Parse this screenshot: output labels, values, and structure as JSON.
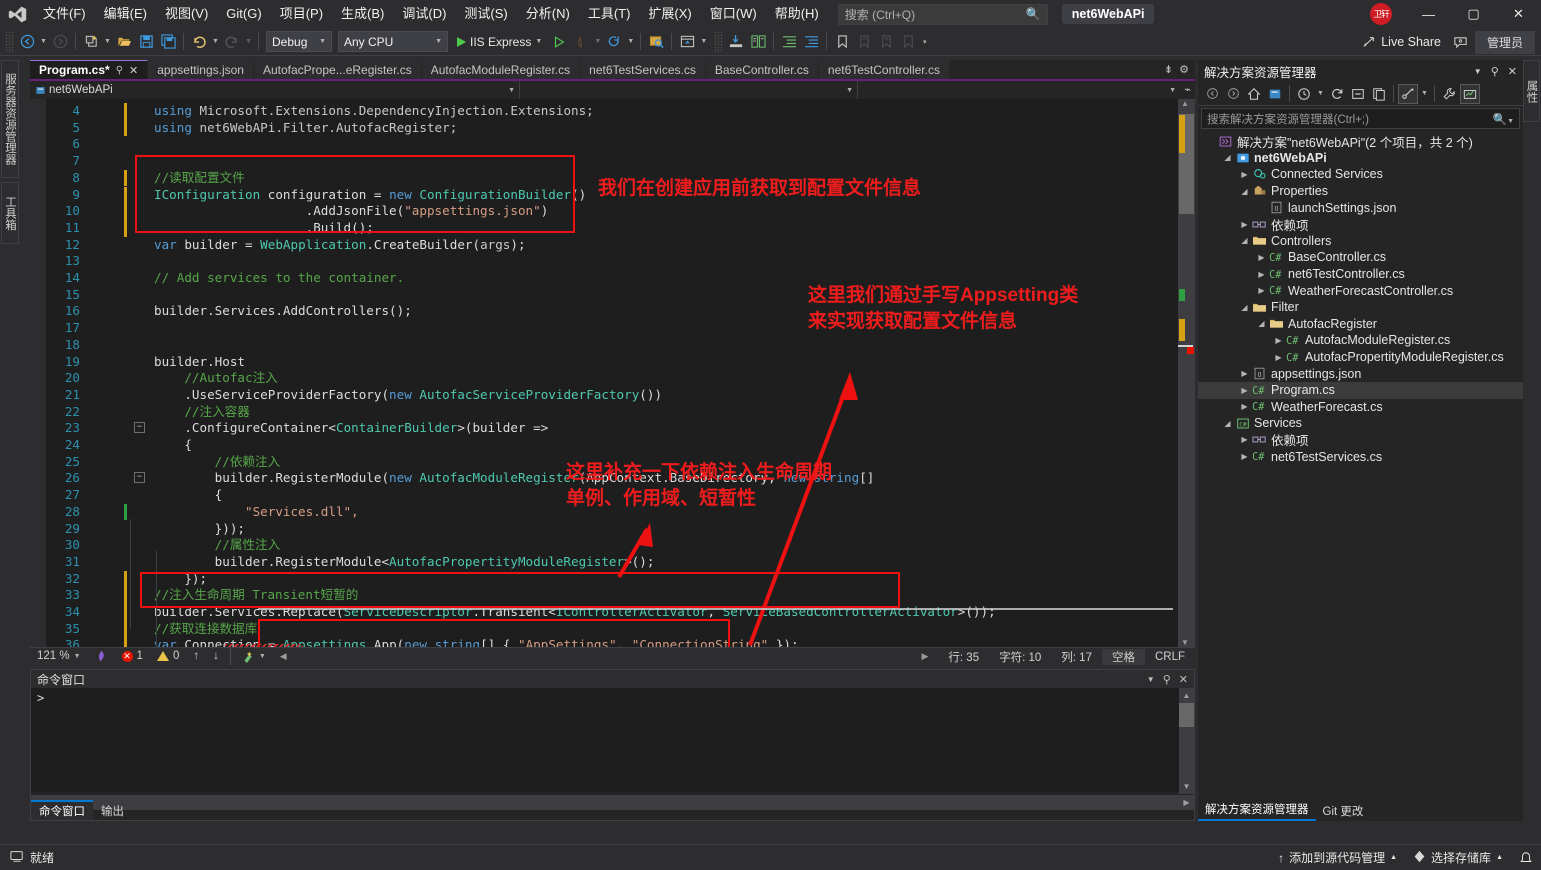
{
  "titlebar": {
    "menu": [
      "文件(F)",
      "编辑(E)",
      "视图(V)",
      "Git(G)",
      "项目(P)",
      "生成(B)",
      "调试(D)",
      "测试(S)",
      "分析(N)",
      "工具(T)",
      "扩展(X)",
      "窗口(W)",
      "帮助(H)"
    ],
    "search_placeholder": "搜索 (Ctrl+Q)",
    "project_chip": "net6WebAPi",
    "avatar_text": "卫轩",
    "minimize": "—",
    "maximize": "▢",
    "close": "✕"
  },
  "toolbar": {
    "config": "Debug",
    "platform": "Any CPU",
    "run_label": "IIS Express",
    "live_share": "Live Share",
    "admin": "管理员"
  },
  "left_dock": {
    "tabs": [
      "服务器资源管理器",
      "工具箱"
    ]
  },
  "right_dock": {
    "tabs": [
      "属性"
    ]
  },
  "editor_tabs": [
    {
      "label": "Program.cs*",
      "active": true,
      "pin": "⚲",
      "close": "✕"
    },
    {
      "label": "appsettings.json",
      "active": false
    },
    {
      "label": "AutofacPrope...eRegister.cs",
      "active": false
    },
    {
      "label": "AutofacModuleRegister.cs",
      "active": false
    },
    {
      "label": "net6TestServices.cs",
      "active": false
    },
    {
      "label": "BaseController.cs",
      "active": false
    },
    {
      "label": "net6TestController.cs",
      "active": false
    }
  ],
  "navbar": {
    "project": "net6WebAPi",
    "type": "",
    "member": ""
  },
  "code": {
    "lines": [
      {
        "n": "4",
        "change": "yellow",
        "indent": 0,
        "tokens": [
          {
            "t": "using ",
            "c": "kw"
          },
          {
            "t": "Microsoft.Extensions.DependencyInjection.Extensions;",
            "c": "nsp"
          }
        ]
      },
      {
        "n": "5",
        "change": "yellow",
        "indent": 0,
        "tokens": [
          {
            "t": "using ",
            "c": "kw"
          },
          {
            "t": "net6WebAPi.Filter.AutofacRegister;",
            "c": "nsp"
          }
        ]
      },
      {
        "n": "6",
        "change": "",
        "indent": 0,
        "tokens": []
      },
      {
        "n": "7",
        "change": "",
        "indent": 0,
        "tokens": []
      },
      {
        "n": "8",
        "change": "yellow",
        "indent": 0,
        "tokens": [
          {
            "t": "//读取配置文件",
            "c": "cmt"
          }
        ]
      },
      {
        "n": "9",
        "change": "yellow",
        "indent": 0,
        "tokens": [
          {
            "t": "IConfiguration",
            "c": "typ"
          },
          {
            "t": " configuration = ",
            "c": "pln"
          },
          {
            "t": "new ",
            "c": "kw"
          },
          {
            "t": "ConfigurationBuilder",
            "c": "typ"
          },
          {
            "t": "()",
            "c": "pln"
          }
        ]
      },
      {
        "n": "10",
        "change": "yellow",
        "indent": 0,
        "tokens": [
          {
            "t": "                    .AddJsonFile(",
            "c": "pln"
          },
          {
            "t": "\"appsettings.json\"",
            "c": "str"
          },
          {
            "t": ")",
            "c": "pln"
          }
        ]
      },
      {
        "n": "11",
        "change": "yellow",
        "indent": 0,
        "tokens": [
          {
            "t": "                    .Build();",
            "c": "pln"
          }
        ]
      },
      {
        "n": "12",
        "change": "",
        "indent": 0,
        "tokens": [
          {
            "t": "var ",
            "c": "kw"
          },
          {
            "t": "builder = ",
            "c": "pln"
          },
          {
            "t": "WebApplication",
            "c": "typ"
          },
          {
            "t": ".CreateBuilder(",
            "c": "pln"
          },
          {
            "t": "args",
            "c": "nsp"
          },
          {
            "t": ");",
            "c": "pln"
          }
        ]
      },
      {
        "n": "13",
        "change": "",
        "indent": 0,
        "tokens": []
      },
      {
        "n": "14",
        "change": "",
        "indent": 0,
        "tokens": [
          {
            "t": "// Add services to the container.",
            "c": "cmt"
          }
        ]
      },
      {
        "n": "15",
        "change": "",
        "indent": 0,
        "tokens": []
      },
      {
        "n": "16",
        "change": "",
        "indent": 0,
        "tokens": [
          {
            "t": "builder.Services.AddControllers();",
            "c": "pln"
          }
        ]
      },
      {
        "n": "17",
        "change": "",
        "indent": 0,
        "tokens": []
      },
      {
        "n": "18",
        "change": "",
        "indent": 0,
        "tokens": []
      },
      {
        "n": "19",
        "change": "",
        "indent": 0,
        "tokens": [
          {
            "t": "builder.Host",
            "c": "pln"
          }
        ]
      },
      {
        "n": "20",
        "change": "",
        "indent": 0,
        "tokens": [
          {
            "t": "    //Autofac注入",
            "c": "cmt"
          }
        ]
      },
      {
        "n": "21",
        "change": "",
        "indent": 0,
        "tokens": [
          {
            "t": "    .UseServiceProviderFactory(",
            "c": "pln"
          },
          {
            "t": "new ",
            "c": "kw"
          },
          {
            "t": "AutofacServiceProviderFactory",
            "c": "typ"
          },
          {
            "t": "())",
            "c": "pln"
          }
        ]
      },
      {
        "n": "22",
        "change": "",
        "indent": 0,
        "tokens": [
          {
            "t": "    //注入容器",
            "c": "cmt"
          }
        ]
      },
      {
        "n": "23",
        "change": "",
        "indent": 0,
        "fold": true,
        "tokens": [
          {
            "t": "    .ConfigureContainer<",
            "c": "pln"
          },
          {
            "t": "ContainerBuilder",
            "c": "typ"
          },
          {
            "t": ">(builder =>",
            "c": "pln"
          }
        ]
      },
      {
        "n": "24",
        "change": "",
        "indent": 0,
        "tokens": [
          {
            "t": "    {",
            "c": "pln"
          }
        ]
      },
      {
        "n": "25",
        "change": "",
        "indent": 0,
        "tokens": [
          {
            "t": "        //依赖注入",
            "c": "cmt"
          }
        ]
      },
      {
        "n": "26",
        "change": "",
        "indent": 0,
        "fold": true,
        "tokens": [
          {
            "t": "        builder.RegisterModule(",
            "c": "pln"
          },
          {
            "t": "new ",
            "c": "kw"
          },
          {
            "t": "AutofacModuleRegister",
            "c": "typ"
          },
          {
            "t": "(AppContext.BaseDirectory, ",
            "c": "pln"
          },
          {
            "t": "new ",
            "c": "kw"
          },
          {
            "t": "string",
            "c": "kw"
          },
          {
            "t": "[]",
            "c": "pln"
          }
        ]
      },
      {
        "n": "27",
        "change": "",
        "indent": 0,
        "tokens": [
          {
            "t": "        {",
            "c": "pln"
          }
        ]
      },
      {
        "n": "28",
        "change": "green",
        "indent": 0,
        "tokens": [
          {
            "t": "            \"Services.dll\",",
            "c": "str"
          }
        ]
      },
      {
        "n": "29",
        "change": "",
        "indent": 0,
        "tokens": [
          {
            "t": "        }));",
            "c": "pln"
          }
        ]
      },
      {
        "n": "30",
        "change": "",
        "indent": 0,
        "tokens": [
          {
            "t": "        //属性注入",
            "c": "cmt"
          }
        ]
      },
      {
        "n": "31",
        "change": "",
        "indent": 0,
        "tokens": [
          {
            "t": "        builder.RegisterModule<",
            "c": "pln"
          },
          {
            "t": "AutofacPropertityModuleRegister",
            "c": "typ"
          },
          {
            "t": ">();",
            "c": "pln"
          }
        ]
      },
      {
        "n": "32",
        "change": "yellow",
        "indent": 0,
        "tokens": [
          {
            "t": "    });",
            "c": "pln"
          }
        ]
      },
      {
        "n": "33",
        "change": "yellow",
        "indent": 0,
        "tokens": [
          {
            "t": "//注入生命周期 Transient短暂的",
            "c": "cmt"
          }
        ]
      },
      {
        "n": "34",
        "change": "yellow",
        "indent": 0,
        "tokens": [
          {
            "t": "builder.Services.Replace(",
            "c": "pln"
          },
          {
            "t": "ServiceDescriptor",
            "c": "typ"
          },
          {
            "t": ".Transient<",
            "c": "pln"
          },
          {
            "t": "IControllerActivator",
            "c": "typ"
          },
          {
            "t": ", ",
            "c": "pln"
          },
          {
            "t": "ServiceBasedControllerActivator",
            "c": "typ"
          },
          {
            "t": ">());",
            "c": "pln"
          }
        ]
      },
      {
        "n": "35",
        "change": "yellow",
        "indent": 0,
        "tokens": [
          {
            "t": "//获取连接数据库",
            "c": "cmt"
          }
        ]
      },
      {
        "n": "36",
        "change": "yellow",
        "indent": 0,
        "tokens": [
          {
            "t": "var ",
            "c": "kw"
          },
          {
            "t": "Connection = ",
            "c": "pln"
          },
          {
            "t": "Appsettings",
            "c": "typ"
          },
          {
            "t": ".App(",
            "c": "pln"
          },
          {
            "t": "new ",
            "c": "kw"
          },
          {
            "t": "string",
            "c": "kw"
          },
          {
            "t": "[] { ",
            "c": "pln"
          },
          {
            "t": "\"AppSettings\"",
            "c": "str"
          },
          {
            "t": ", ",
            "c": "pln"
          },
          {
            "t": "\"ConnectionString\"",
            "c": "str"
          },
          {
            "t": " });",
            "c": "pln"
          }
        ]
      }
    ]
  },
  "annotations": [
    {
      "id": "anno-1",
      "text": "我们在创建应用前获取到配置文件信息"
    },
    {
      "id": "anno-2",
      "text": "这里我们通过手写Appsetting类\n来实现获取配置文件信息"
    },
    {
      "id": "anno-3",
      "text": "这里补充一下依赖注入生命周期\n单例、作用域、短暂性"
    }
  ],
  "editor_status": {
    "zoom": "121 %",
    "errors": "1",
    "warnings": "0",
    "line": "行: 35",
    "chars": "字符: 10",
    "col": "列: 17",
    "spaces": "空格",
    "eol": "CRLF"
  },
  "command_window": {
    "title": "命令窗口",
    "prompt": ">",
    "tabs": [
      {
        "label": "命令窗口",
        "active": true
      },
      {
        "label": "输出",
        "active": false
      }
    ]
  },
  "solution_explorer": {
    "title": "解决方案资源管理器",
    "search_placeholder": "搜索解决方案资源管理器(Ctrl+;)",
    "tree": [
      {
        "depth": 0,
        "tw": "",
        "icon": "solution",
        "label": "解决方案\"net6WebAPi\"(2 个项目，共 2 个)",
        "bold": false,
        "sel": false
      },
      {
        "depth": 1,
        "tw": "▾",
        "icon": "project",
        "label": "net6WebAPi",
        "bold": true,
        "sel": false
      },
      {
        "depth": 2,
        "tw": "▸",
        "icon": "connected",
        "label": "Connected Services",
        "bold": false,
        "sel": false
      },
      {
        "depth": 2,
        "tw": "▾",
        "icon": "props",
        "label": "Properties",
        "bold": false,
        "sel": false
      },
      {
        "depth": 3,
        "tw": "",
        "icon": "json",
        "label": "launchSettings.json",
        "bold": false,
        "sel": false
      },
      {
        "depth": 2,
        "tw": "▸",
        "icon": "deps",
        "label": "依赖项",
        "bold": false,
        "sel": false
      },
      {
        "depth": 2,
        "tw": "▾",
        "icon": "folder",
        "label": "Controllers",
        "bold": false,
        "sel": false
      },
      {
        "depth": 3,
        "tw": "▸",
        "icon": "cs",
        "label": "BaseController.cs",
        "bold": false,
        "sel": false
      },
      {
        "depth": 3,
        "tw": "▸",
        "icon": "cs",
        "label": "net6TestController.cs",
        "bold": false,
        "sel": false
      },
      {
        "depth": 3,
        "tw": "▸",
        "icon": "cs",
        "label": "WeatherForecastController.cs",
        "bold": false,
        "sel": false
      },
      {
        "depth": 2,
        "tw": "▾",
        "icon": "folder",
        "label": "Filter",
        "bold": false,
        "sel": false
      },
      {
        "depth": 3,
        "tw": "▾",
        "icon": "folder",
        "label": "AutofacRegister",
        "bold": false,
        "sel": false
      },
      {
        "depth": 4,
        "tw": "▸",
        "icon": "cs",
        "label": "AutofacModuleRegister.cs",
        "bold": false,
        "sel": false
      },
      {
        "depth": 4,
        "tw": "▸",
        "icon": "cs",
        "label": "AutofacPropertityModuleRegister.cs",
        "bold": false,
        "sel": false
      },
      {
        "depth": 2,
        "tw": "▸",
        "icon": "json",
        "label": "appsettings.json",
        "bold": false,
        "sel": false
      },
      {
        "depth": 2,
        "tw": "▸",
        "icon": "cs",
        "label": "Program.cs",
        "bold": false,
        "sel": true
      },
      {
        "depth": 2,
        "tw": "▸",
        "icon": "cs",
        "label": "WeatherForecast.cs",
        "bold": false,
        "sel": false
      },
      {
        "depth": 1,
        "tw": "▾",
        "icon": "csproj",
        "label": "Services",
        "bold": false,
        "sel": false
      },
      {
        "depth": 2,
        "tw": "▸",
        "icon": "deps",
        "label": "依赖项",
        "bold": false,
        "sel": false
      },
      {
        "depth": 2,
        "tw": "▸",
        "icon": "cs",
        "label": "net6TestServices.cs",
        "bold": false,
        "sel": false
      }
    ],
    "footer_tabs": [
      {
        "label": "解决方案资源管理器",
        "active": true
      },
      {
        "label": "Git 更改",
        "active": false
      }
    ]
  },
  "statusbar": {
    "ready": "就绪",
    "source_control": "添加到源代码管理",
    "repo": "选择存储库",
    "bell": "🔔"
  },
  "colors": {
    "accent_purple": "#68217a",
    "annotation_red": "#ee1c1c",
    "selection_blue": "#0078d4",
    "chrome": "#2d2d30",
    "editor_bg": "#1e1e1e"
  }
}
